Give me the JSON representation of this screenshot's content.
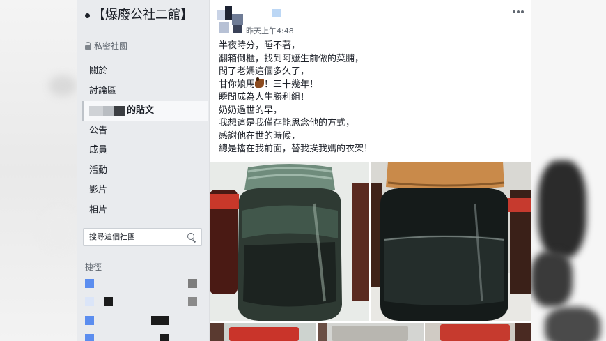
{
  "group": {
    "name": "【爆廢公社二館】",
    "privacy": "私密社團"
  },
  "sidebar": {
    "items": [
      {
        "label": "關於"
      },
      {
        "label": "討論區"
      },
      {
        "label": "的貼文"
      },
      {
        "label": "公告"
      },
      {
        "label": "成員"
      },
      {
        "label": "活動"
      },
      {
        "label": "影片"
      },
      {
        "label": "相片"
      }
    ],
    "search_placeholder": "搜尋這個社團",
    "shortcuts_title": "捷徑"
  },
  "post": {
    "timestamp": "昨天上午4:48",
    "lines": [
      "半夜時分，睡不著，",
      "翻箱倒櫃，找到阿嬤生前做的菜脯，",
      "問了老媽這個多久了，",
      "甘你娘馬",
      "！三十幾年！",
      "瞬間成為人生勝利組！",
      "奶奶過世的早，",
      "我想這是我僅存能思念他的方式，",
      "感謝他在世的時候，",
      "總是擋在我前面，替我挨我媽的衣架！"
    ],
    "emoji_icon": "horse-icon"
  },
  "colors": {
    "sidebar_bg": "#e9ebee",
    "text": "#1d2129",
    "muted": "#606770",
    "redact_blue": "#5b8def"
  }
}
